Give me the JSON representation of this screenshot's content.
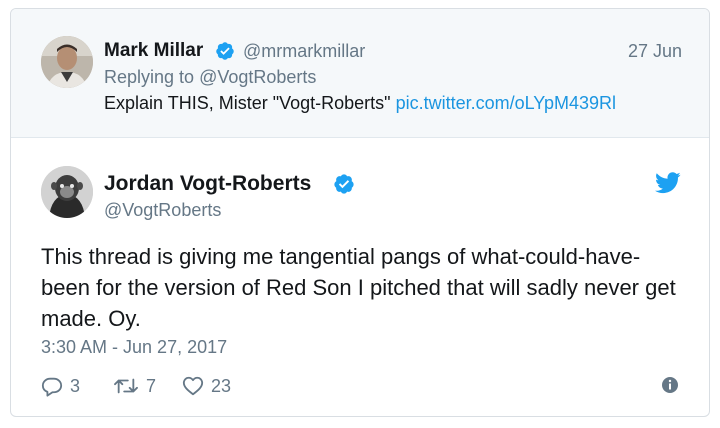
{
  "parent_tweet": {
    "author_name": "Mark Millar",
    "author_handle": "@mrmarkmillar",
    "date": "27 Jun",
    "replying_prefix": "Replying to ",
    "replying_to": "@VogtRoberts",
    "text": "Explain THIS, Mister \"Vogt-Roberts\" ",
    "link": "pic.twitter.com/oLYpM439Rl"
  },
  "tweet": {
    "author_name": "Jordan Vogt-Roberts",
    "author_handle": "@VogtRoberts",
    "text": "This thread is giving me tangential pangs of what-could-have-been for the version of Red Son I pitched that will sadly never get made. Oy.",
    "timestamp": "3:30 AM - Jun 27, 2017",
    "replies": "3",
    "retweets": "7",
    "likes": "23"
  },
  "icons": {
    "verified": "verified-badge-icon",
    "bird": "twitter-bird-icon",
    "reply": "reply-icon",
    "retweet": "retweet-icon",
    "like": "heart-icon",
    "info": "info-icon"
  },
  "colors": {
    "brand_blue": "#1da1f2",
    "link_blue": "#1b95e0",
    "muted_text": "#657786",
    "parent_background": "#f5f8fa"
  }
}
